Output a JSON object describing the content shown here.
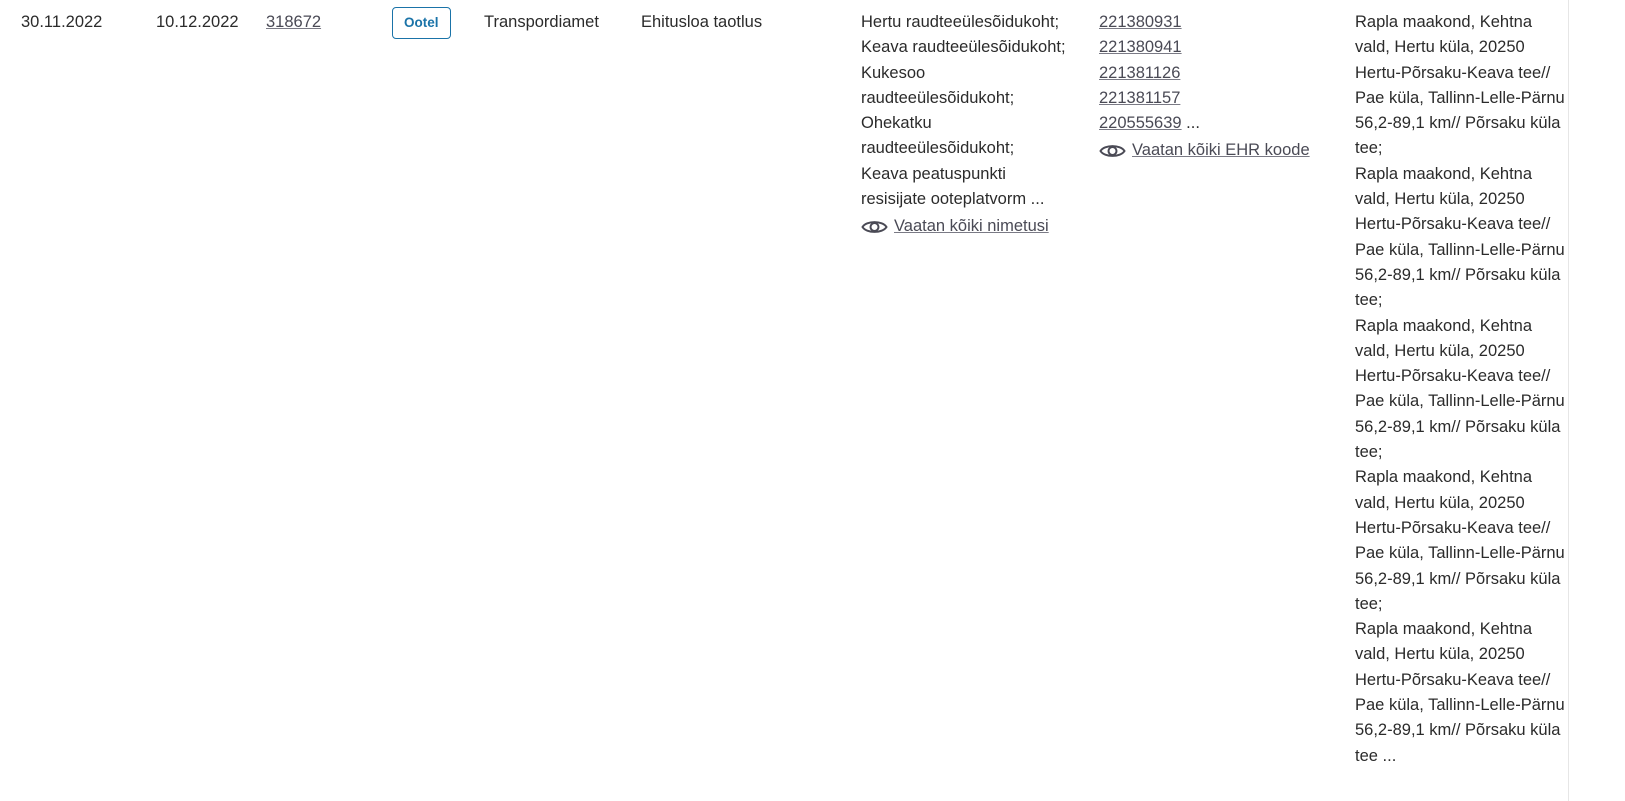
{
  "row": {
    "start_date": "30.11.2022",
    "end_date": "10.12.2022",
    "doc_number": "318672",
    "status": "Ootel",
    "organization": "Transpordiamet",
    "doc_type": "Ehitusloa taotlus",
    "names": [
      "Hertu raudteeülesõidukoht;",
      "Keava raudteeülesõidukoht;",
      "Kukesoo",
      "raudteeülesõidukoht;",
      "Ohekatku",
      "raudteeülesõidukoht;",
      "Keava peatuspunkti",
      "resisijate ooteplatvorm ..."
    ],
    "names_view_all": "Vaatan kõiki nimetusi",
    "ehr_codes": [
      "221380931",
      "221380941",
      "221381126",
      "221381157",
      "220555639"
    ],
    "ehr_more": " ...",
    "ehr_view_all": "Vaatan kõiki EHR koode",
    "address_lines": [
      "Rapla maakond, Kehtna",
      "vald, Hertu küla, 20250",
      "Hertu-Põrsaku-Keava tee//",
      "Pae küla, Tallinn-Lelle-Pärnu",
      "56,2-89,1 km// Põrsaku küla",
      "tee;",
      "Rapla maakond, Kehtna",
      "vald, Hertu küla, 20250",
      "Hertu-Põrsaku-Keava tee//",
      "Pae küla, Tallinn-Lelle-Pärnu",
      "56,2-89,1 km// Põrsaku küla",
      "tee;",
      "Rapla maakond, Kehtna",
      "vald, Hertu küla, 20250",
      "Hertu-Põrsaku-Keava tee//",
      "Pae küla, Tallinn-Lelle-Pärnu",
      "56,2-89,1 km// Põrsaku küla",
      "tee;",
      "Rapla maakond, Kehtna",
      "vald, Hertu küla, 20250",
      "Hertu-Põrsaku-Keava tee//",
      "Pae küla, Tallinn-Lelle-Pärnu",
      "56,2-89,1 km// Põrsaku küla",
      "tee;",
      "Rapla maakond, Kehtna",
      "vald, Hertu küla, 20250",
      "Hertu-Põrsaku-Keava tee//",
      "Pae küla, Tallinn-Lelle-Pärnu",
      "56,2-89,1 km// Põrsaku küla",
      "tee ..."
    ]
  },
  "icons": {
    "view": "eye-icon"
  },
  "colors": {
    "status_accent": "#1a73a8",
    "text": "#2b2b2b",
    "link": "#4a4a55"
  }
}
